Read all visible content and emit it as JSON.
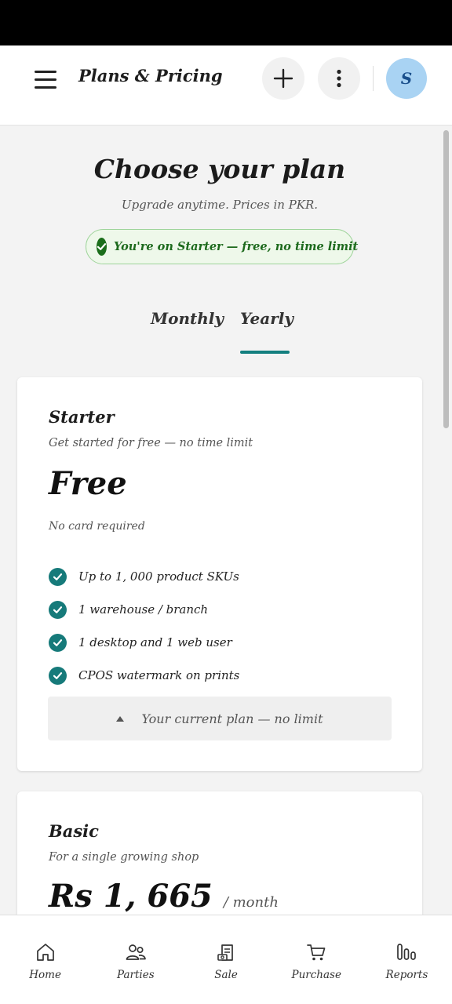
{
  "header": {
    "title": "Plans & Pricing",
    "avatar_initial": "S"
  },
  "intro": {
    "heading": "Choose your plan",
    "subheading": "Upgrade anytime.  Prices in PKR.",
    "status": "You're on Starter — free,  no time limit"
  },
  "billing_tabs": {
    "items": [
      "Monthly",
      "Yearly"
    ],
    "selected": "Yearly"
  },
  "plans": [
    {
      "name": "Starter",
      "description": "Get started for free — no time limit",
      "price": "Free",
      "note": "No card required",
      "features": [
        "Up to 1, 000 product SKUs",
        "1 warehouse / branch",
        "1 desktop and 1 web user",
        "CPOS watermark on prints"
      ],
      "action_label": "Your current plan — no limit"
    },
    {
      "name": "Basic",
      "description": "For a single growing shop",
      "price": "Rs 1, 665",
      "period": "/ month"
    }
  ],
  "bottom_nav": {
    "items": [
      "Home",
      "Parties",
      "Sale",
      "Purchase",
      "Reports"
    ]
  },
  "colors": {
    "accent": "#137f7f",
    "status_green": "#1d6a1d",
    "status_bg": "#eef8ea",
    "avatar_bg": "#a9d3f3"
  },
  "icons": [
    "menu-icon",
    "plus-icon",
    "more-vertical-icon",
    "check-icon",
    "caret-up-icon",
    "home-icon",
    "parties-icon",
    "sale-icon",
    "purchase-icon",
    "reports-icon"
  ]
}
